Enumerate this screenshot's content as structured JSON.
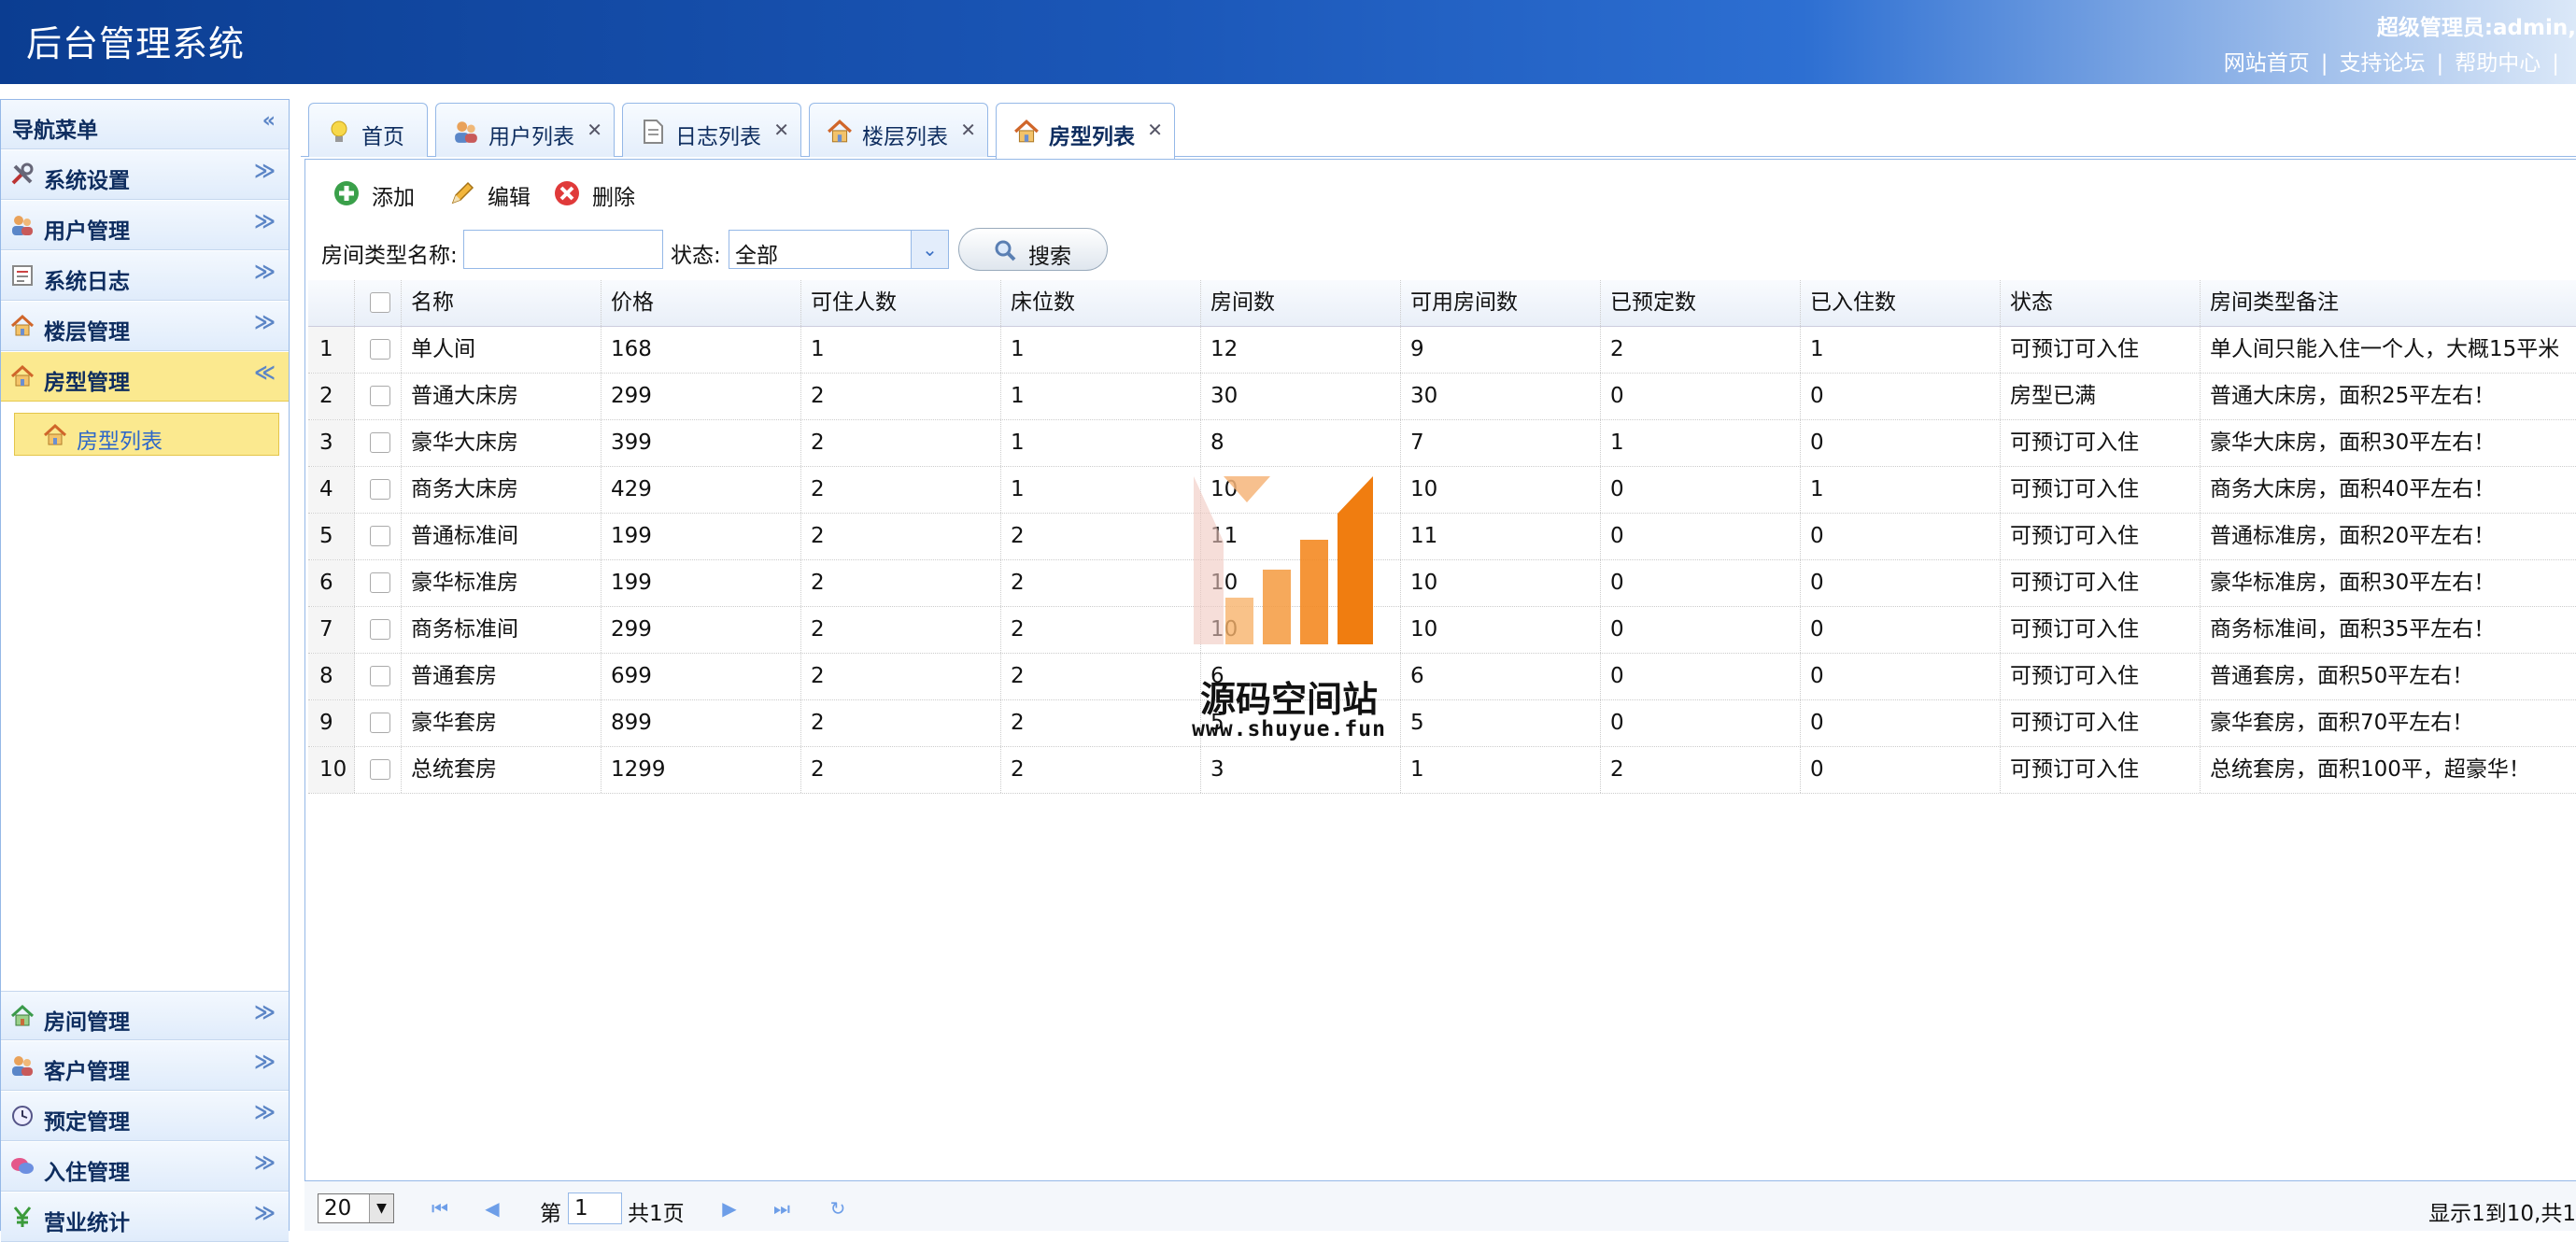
{
  "header": {
    "title": "后台管理系统",
    "greeting": "超级管理员:admin,",
    "links": [
      "网站首页",
      "支持论坛",
      "帮助中心"
    ],
    "separator": "|"
  },
  "sidebar": {
    "title": "导航菜单",
    "groups": [
      {
        "label": "系统设置",
        "icon": "tools-icon"
      },
      {
        "label": "用户管理",
        "icon": "users-icon"
      },
      {
        "label": "系统日志",
        "icon": "log-icon"
      },
      {
        "label": "楼层管理",
        "icon": "building-icon"
      },
      {
        "label": "房型管理",
        "icon": "house-icon",
        "active": true
      },
      {
        "label": "房间管理",
        "icon": "house-icon"
      },
      {
        "label": "客户管理",
        "icon": "users-icon"
      },
      {
        "label": "预定管理",
        "icon": "clock-icon"
      },
      {
        "label": "入住管理",
        "icon": "chat-icon"
      },
      {
        "label": "营业统计",
        "icon": "yen-icon"
      }
    ],
    "sub_item": "房型列表"
  },
  "tabs": [
    {
      "label": "首页",
      "closable": false
    },
    {
      "label": "用户列表",
      "closable": true
    },
    {
      "label": "日志列表",
      "closable": true
    },
    {
      "label": "楼层列表",
      "closable": true
    },
    {
      "label": "房型列表",
      "closable": true,
      "active": true
    }
  ],
  "toolbar": {
    "add": "添加",
    "edit": "编辑",
    "delete": "删除"
  },
  "search": {
    "name_label": "房间类型名称:",
    "name_value": "",
    "status_label": "状态:",
    "status_value": "全部",
    "button": "搜索"
  },
  "grid": {
    "columns": [
      "名称",
      "价格",
      "可住人数",
      "床位数",
      "房间数",
      "可用房间数",
      "已预定数",
      "已入住数",
      "状态",
      "房间类型备注"
    ],
    "rows": [
      [
        "1",
        "单人间",
        "168",
        "1",
        "1",
        "12",
        "9",
        "2",
        "1",
        "可预订可入住",
        "单人间只能入住一个人，大概15平米"
      ],
      [
        "2",
        "普通大床房",
        "299",
        "2",
        "1",
        "30",
        "30",
        "0",
        "0",
        "房型已满",
        "普通大床房，面积25平左右！"
      ],
      [
        "3",
        "豪华大床房",
        "399",
        "2",
        "1",
        "8",
        "7",
        "1",
        "0",
        "可预订可入住",
        "豪华大床房，面积30平左右！"
      ],
      [
        "4",
        "商务大床房",
        "429",
        "2",
        "1",
        "10",
        "10",
        "0",
        "1",
        "可预订可入住",
        "商务大床房，面积40平左右！"
      ],
      [
        "5",
        "普通标准间",
        "199",
        "2",
        "2",
        "11",
        "11",
        "0",
        "0",
        "可预订可入住",
        "普通标准房，面积20平左右！"
      ],
      [
        "6",
        "豪华标准房",
        "199",
        "2",
        "2",
        "10",
        "10",
        "0",
        "0",
        "可预订可入住",
        "豪华标准房，面积30平左右！"
      ],
      [
        "7",
        "商务标准间",
        "299",
        "2",
        "2",
        "10",
        "10",
        "0",
        "0",
        "可预订可入住",
        "商务标准间，面积35平左右！"
      ],
      [
        "8",
        "普通套房",
        "699",
        "2",
        "2",
        "6",
        "6",
        "0",
        "0",
        "可预订可入住",
        "普通套房，面积50平左右！"
      ],
      [
        "9",
        "豪华套房",
        "899",
        "2",
        "2",
        "5",
        "5",
        "0",
        "0",
        "可预订可入住",
        "豪华套房，面积70平左右！"
      ],
      [
        "10",
        "总统套房",
        "1299",
        "2",
        "2",
        "3",
        "1",
        "2",
        "0",
        "可预订可入住",
        "总统套房，面积100平，超豪华！"
      ]
    ]
  },
  "pager": {
    "page_size": "20",
    "page_prefix": "第",
    "page_value": "1",
    "page_total": "共1页",
    "info": "显示1到10,共1"
  },
  "watermark": {
    "text": "源码空间站",
    "url": "www.shuyue.fun"
  },
  "colors": {
    "header": "#1b57b8",
    "accent_border": "#95b8e7",
    "active": "#fbe98f"
  }
}
